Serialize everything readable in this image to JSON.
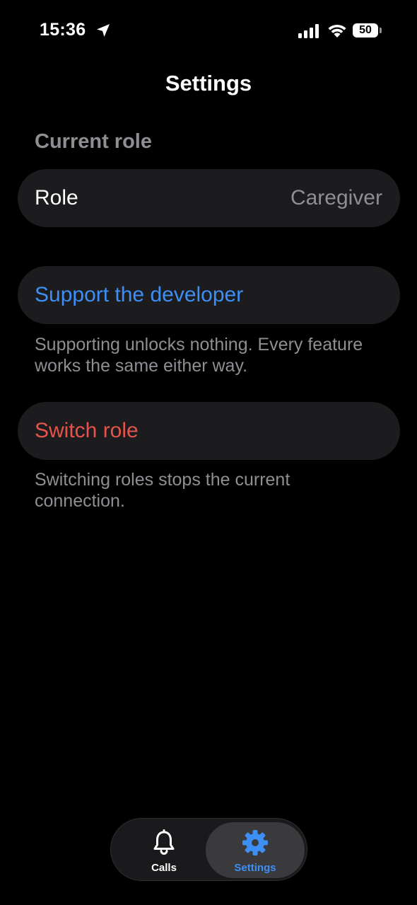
{
  "status_bar": {
    "time": "15:36",
    "battery_level": "50",
    "icons": [
      "location-arrow-icon",
      "cellular-signal-icon",
      "wifi-icon",
      "battery-icon"
    ]
  },
  "header": {
    "title": "Settings"
  },
  "current_role_section": {
    "header": "Current role",
    "row_label": "Role",
    "row_value": "Caregiver"
  },
  "support_section": {
    "button_label": "Support the developer",
    "footnote": "Supporting unlocks nothing. Every feature works the same either way."
  },
  "switch_section": {
    "button_label": "Switch role",
    "footnote": "Switching roles stops the current connection."
  },
  "tab_bar": {
    "tabs": [
      {
        "label": "Calls",
        "icon": "bell-icon",
        "selected": false
      },
      {
        "label": "Settings",
        "icon": "gear-icon",
        "selected": true
      }
    ]
  },
  "colors": {
    "background": "#000000",
    "card": "#1c1c1e",
    "secondary_text": "#8e8e93",
    "accent_blue": "#3d8ef5",
    "destructive_red": "#e5534b"
  }
}
